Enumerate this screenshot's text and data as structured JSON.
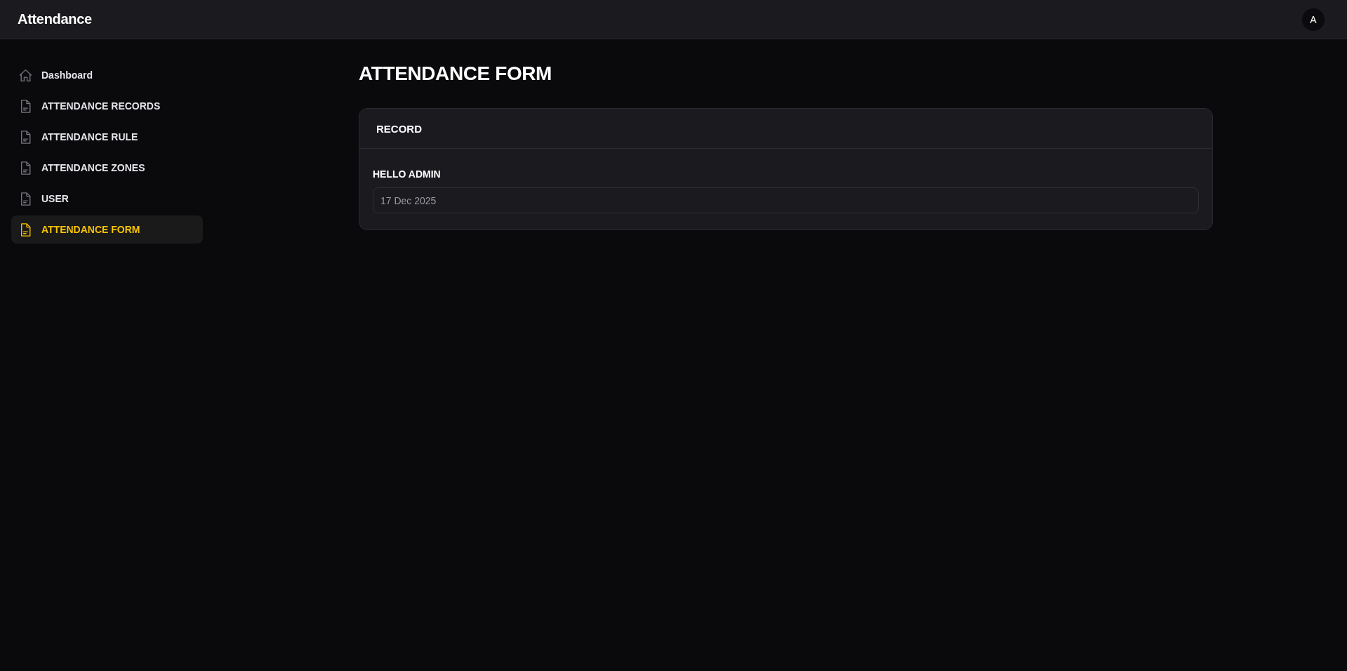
{
  "app": {
    "title": "Attendance",
    "avatar": "A"
  },
  "sidebar": {
    "items": [
      {
        "label": "Dashboard",
        "kind": "home",
        "selected": false
      },
      {
        "label": "ATTENDANCE RECORDS",
        "kind": "file",
        "selected": false
      },
      {
        "label": "ATTENDANCE RULE",
        "kind": "file",
        "selected": false
      },
      {
        "label": "ATTENDANCE ZONES",
        "kind": "file",
        "selected": false
      },
      {
        "label": "USER",
        "kind": "file",
        "selected": false
      },
      {
        "label": "ATTENDANCE FORM",
        "kind": "file",
        "selected": true
      }
    ]
  },
  "page": {
    "title": "ATTENDANCE FORM"
  },
  "card": {
    "title": "RECORD",
    "fields": [
      {
        "label": "HELLO ADMIN",
        "value": "17 Dec 2025"
      }
    ]
  }
}
